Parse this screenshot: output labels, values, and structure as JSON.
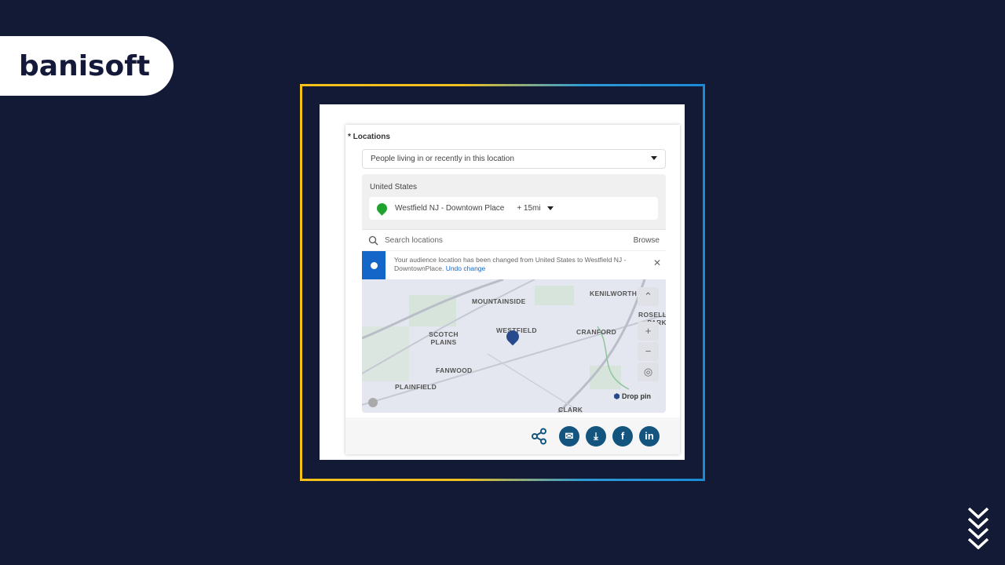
{
  "brand": {
    "logo_text": "banisoft"
  },
  "form": {
    "locations_label": "* Locations",
    "audience_type": "People living in or recently in this location",
    "country": "United States",
    "location": {
      "name": "Westfield NJ - Downtown Place",
      "radius": "+ 15mi"
    },
    "search_placeholder": "Search locations",
    "browse_label": "Browse",
    "notification": {
      "text": "Your audience location has been changed from United States to Westfield NJ - DowntownPlace.",
      "undo_label": "Undo change"
    }
  },
  "map": {
    "places": [
      "MOUNTAINSIDE",
      "KENILWORTH",
      "ROSELLE PARK",
      "SCOTCH PLAINS",
      "WESTFIELD",
      "CRANFORD",
      "FANWOOD",
      "PLAINFIELD",
      "CLARK"
    ],
    "drop_pin_label": "Drop pin"
  },
  "share": {
    "icons": [
      "share-icon",
      "email-icon",
      "download-icon",
      "facebook-icon",
      "linkedin-icon"
    ],
    "facebook": "f",
    "linkedin": "in"
  },
  "colors": {
    "background": "#121a36",
    "accent_yellow": "#f5c118",
    "accent_blue": "#1b8ad6",
    "share_button": "#14557f",
    "info": "#1467c8",
    "pin_green": "#1fa22e"
  }
}
